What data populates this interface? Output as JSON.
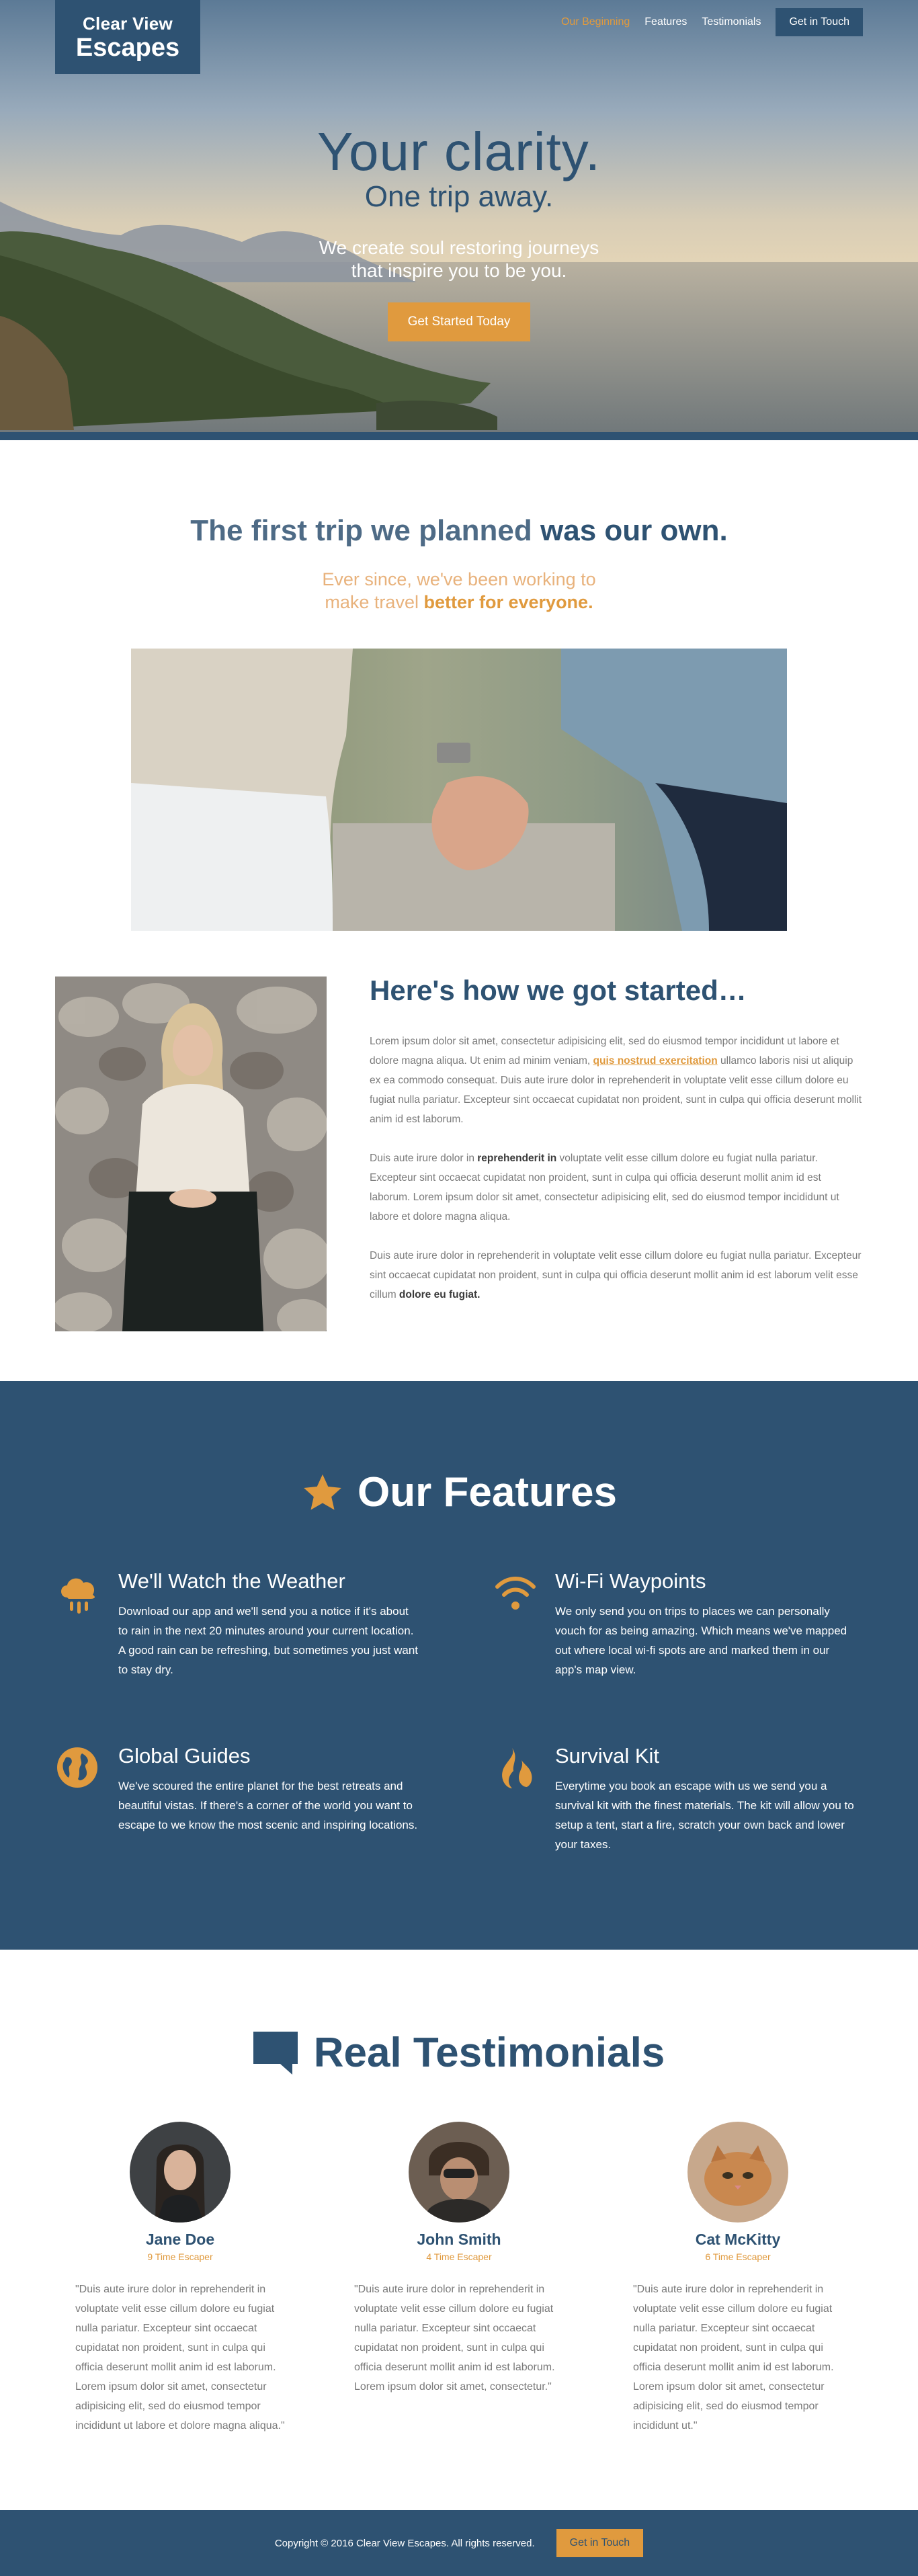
{
  "brand": {
    "line1": "Clear View",
    "line2": "Escapes"
  },
  "nav": {
    "items": [
      "Our Beginning",
      "Features",
      "Testimonials"
    ],
    "cta": "Get in Touch"
  },
  "hero": {
    "title": "Your clarity.",
    "subtitle": "One trip away.",
    "desc_line1": "We create soul restoring journeys",
    "desc_line2": "that inspire you to be you.",
    "cta": "Get Started Today"
  },
  "story": {
    "heading_light": "The first trip we planned",
    "heading_bold": "was our own.",
    "sub_line1": "Ever since, we've been working to",
    "sub_line2_light": "make travel",
    "sub_line2_bold": "better for everyone.",
    "started_title": "Here's how we got started…",
    "p1_a": "Lorem ipsum dolor sit amet, consectetur adipisicing elit, sed do eiusmod tempor incididunt ut labore et dolore magna aliqua. Ut enim ad minim veniam, ",
    "p1_link": "quis nostrud exercitation",
    "p1_b": " ullamco laboris nisi ut aliquip ex ea commodo consequat. Duis aute irure dolor in reprehenderit in voluptate velit esse cillum dolore eu fugiat nulla pariatur. Excepteur sint occaecat cupidatat non proident, sunt in culpa qui officia deserunt mollit anim id est laborum.",
    "p2_a": "Duis aute irure dolor in ",
    "p2_bold": "reprehenderit in",
    "p2_b": " voluptate velit esse cillum dolore eu fugiat nulla pariatur. Excepteur sint occaecat cupidatat non proident, sunt in culpa qui officia deserunt mollit anim id est laborum. Lorem ipsum dolor sit amet, consectetur adipisicing elit, sed do eiusmod tempor incididunt ut labore et dolore magna aliqua.",
    "p3_a": "Duis aute irure dolor in reprehenderit in voluptate velit esse cillum dolore eu fugiat nulla pariatur. Excepteur sint occaecat cupidatat non proident, sunt in culpa qui officia deserunt mollit anim id est laborum velit esse cillum ",
    "p3_bold": "dolore eu fugiat."
  },
  "features": {
    "heading_light": "Our",
    "heading_bold": "Features",
    "items": [
      {
        "icon": "cloud-rain-icon",
        "title": "We'll Watch the Weather",
        "text": "Download our app and we'll send you a notice if it's about to rain in the next 20 minutes around your current location. A good rain can be refreshing, but sometimes you just want to stay dry."
      },
      {
        "icon": "wifi-icon",
        "title": "Wi-Fi Waypoints",
        "text": "We only send you on trips to places we can personally vouch for as being amazing. Which means we've mapped out where local wi-fi spots are and marked them in our app's map view."
      },
      {
        "icon": "globe-icon",
        "title": "Global Guides",
        "text": "We've scoured the entire planet for the best retreats and beautiful vistas. If there's a corner of the world you want to escape to we know the most scenic and inspiring locations."
      },
      {
        "icon": "fire-icon",
        "title": "Survival Kit",
        "text": "Everytime you book an escape with us we send you a survival kit with the finest materials. The kit will allow you to setup a tent, start a fire, scratch your own back and lower your taxes."
      }
    ]
  },
  "testimonials": {
    "heading_light": "Real",
    "heading_bold": "Testimonials",
    "items": [
      {
        "name": "Jane Doe",
        "escapes": "9 Time Escaper",
        "quote": "\"Duis aute irure dolor in reprehenderit in voluptate velit esse cillum dolore eu fugiat nulla pariatur. Excepteur sint occaecat cupidatat non proident, sunt in culpa qui officia deserunt mollit anim id est laborum. Lorem ipsum dolor sit amet, consectetur adipisicing elit, sed do eiusmod tempor incididunt ut labore et dolore magna aliqua.\""
      },
      {
        "name": "John Smith",
        "escapes": "4 Time Escaper",
        "quote": "\"Duis aute irure dolor in reprehenderit in voluptate velit esse cillum dolore eu fugiat nulla pariatur. Excepteur sint occaecat cupidatat non proident, sunt in culpa qui officia deserunt mollit anim id est laborum. Lorem ipsum dolor sit amet, consectetur.\""
      },
      {
        "name": "Cat McKitty",
        "escapes": "6 Time Escaper",
        "quote": "\"Duis aute irure dolor in reprehenderit in voluptate velit esse cillum dolore eu fugiat nulla pariatur. Excepteur sint occaecat cupidatat non proident, sunt in culpa qui officia deserunt mollit anim id est laborum. Lorem ipsum dolor sit amet, consectetur adipisicing elit, sed do eiusmod tempor incididunt ut.\""
      }
    ]
  },
  "footer": {
    "copyright": "Copyright © 2016 Clear View Escapes. All rights reserved.",
    "cta": "Get in Touch"
  },
  "colors": {
    "navy": "#2e5272",
    "accent": "#e09a3e"
  }
}
